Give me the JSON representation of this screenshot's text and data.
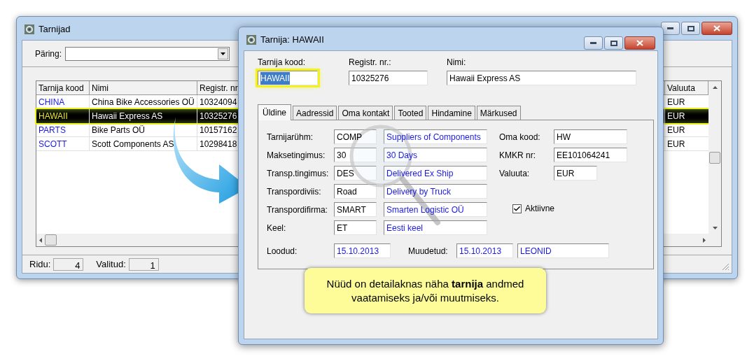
{
  "list_window": {
    "title": "Tarnijad",
    "query_label": "Päring:",
    "table": {
      "columns": [
        "Tarnija kood",
        "Nimi",
        "Registr. nr",
        "Valuuta"
      ],
      "rows": [
        {
          "cells": [
            "CHINA",
            "China Bike Accessories OÜ",
            "10324094",
            "EUR"
          ],
          "selected": false
        },
        {
          "cells": [
            "HAWAII",
            "Hawaii Express AS",
            "10325276",
            "EUR"
          ],
          "selected": true
        },
        {
          "cells": [
            "PARTS",
            "Bike Parts OÜ",
            "10157162",
            "EUR"
          ],
          "selected": false
        },
        {
          "cells": [
            "SCOTT",
            "Scott Components AS",
            "10298418",
            "EUR"
          ],
          "selected": false
        }
      ]
    },
    "status_bar": [
      {
        "label": "Ridu:",
        "value": "4"
      },
      {
        "label": "Valitud:",
        "value": "1"
      }
    ]
  },
  "detail_window": {
    "title": "Tarnija: HAWAII",
    "header_fields": [
      {
        "label": "Tarnija kood:",
        "value": "HAWAII",
        "focused": true
      },
      {
        "label": "Registr. nr.:",
        "value": "10325276",
        "focused": false
      },
      {
        "label": "Nimi:",
        "value": "Hawaii Express AS",
        "focused": false
      }
    ],
    "tabs": [
      {
        "label": "Üldine",
        "selected": true
      },
      {
        "label": "Aadressid",
        "selected": false
      },
      {
        "label": "Oma kontakt",
        "selected": false
      },
      {
        "label": "Tooted",
        "selected": false
      },
      {
        "label": "Hindamine",
        "selected": false
      },
      {
        "label": "Märkused",
        "selected": false
      }
    ],
    "left_rows": [
      {
        "label": "Tarnijarühm:",
        "code": "COMP",
        "description": "Suppliers of Components"
      },
      {
        "label": "Maksetingimus:",
        "code": "30",
        "description": "30 Days"
      },
      {
        "label": "Transp.tingimus:",
        "code": "DES",
        "description": "Delivered Ex Ship"
      },
      {
        "label": "Transpordiviis:",
        "code": "Road",
        "description": "Delivery by Truck"
      },
      {
        "label": "Transpordifirma:",
        "code": "SMART",
        "description": "Smarten Logistic OÜ"
      },
      {
        "label": "Keel:",
        "code": "ET",
        "description": "Eesti keel"
      }
    ],
    "right_rows": [
      {
        "label": "Oma kood:",
        "value": "HW",
        "kind": "wide"
      },
      {
        "label": "KMKR nr:",
        "value": "EE101064241",
        "kind": "wide"
      },
      {
        "label": "Valuuta:",
        "value": "EUR",
        "kind": "narrow"
      }
    ],
    "active_checkbox": {
      "label": "Aktiivne",
      "checked": true
    },
    "footer": [
      {
        "label": "Loodud:",
        "values": [
          "15.10.2013"
        ]
      },
      {
        "label": "Muudetud:",
        "values": [
          "15.10.2013",
          "LEONID"
        ]
      }
    ]
  },
  "callout": "Nüüd on detailaknas näha **tarnija** andmed vaatamiseks ja/või muutmiseks."
}
